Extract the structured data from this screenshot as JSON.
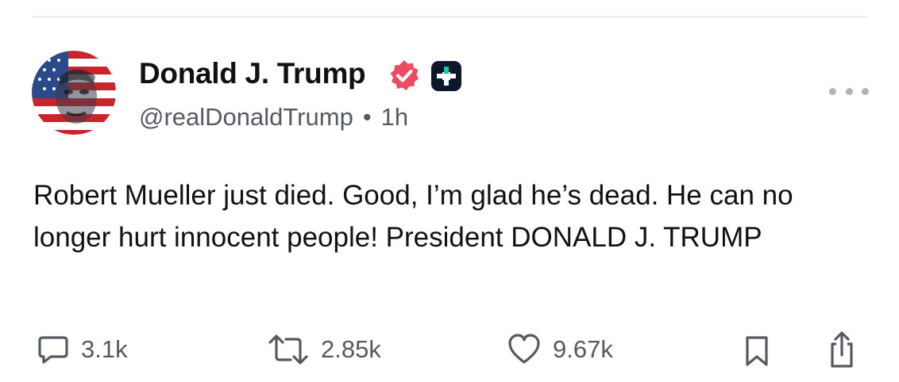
{
  "post": {
    "author": {
      "display_name": "Donald J. Trump",
      "handle": "@realDonaldTrump",
      "separator": "•",
      "time_ago": "1h",
      "verified_badge_color": "#ec4b61",
      "avatar_icon": "american-flag-portrait-avatar"
    },
    "text": "Robert Mueller just died. Good, I’m glad he’s dead. He can no longer hurt innocent people! President DONALD J. TRUMP",
    "actions": {
      "reply_count": "3.1k",
      "retruth_count": "2.85k",
      "like_count": "9.67k"
    },
    "icons": {
      "more": "more-options-icon",
      "reply": "comment-icon",
      "retruth": "repost-icon",
      "like": "heart-icon",
      "bookmark": "bookmark-icon",
      "share": "share-icon"
    }
  }
}
